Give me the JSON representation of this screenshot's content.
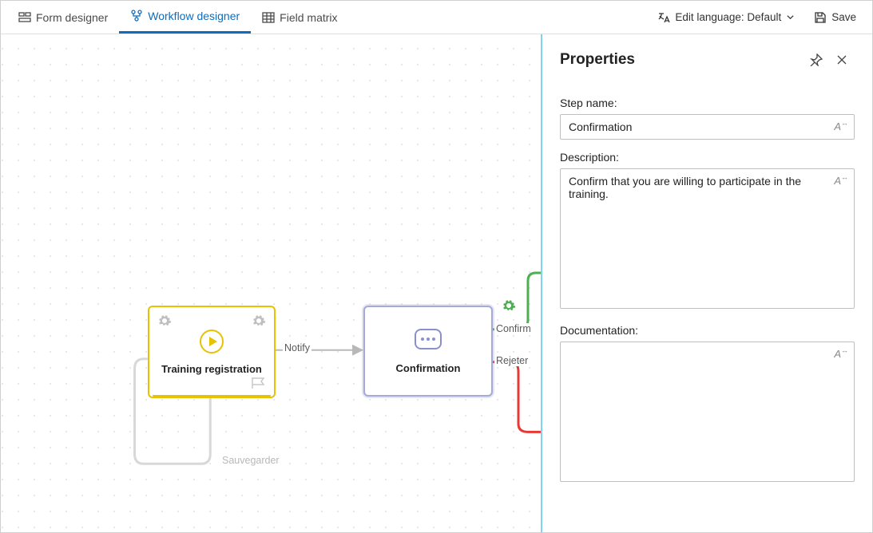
{
  "tabs": {
    "form": {
      "label": "Form designer"
    },
    "workflow": {
      "label": "Workflow designer"
    },
    "matrix": {
      "label": "Field matrix"
    }
  },
  "toolbar": {
    "edit_lang_label": "Edit language: Default",
    "save_label": "Save"
  },
  "canvas": {
    "node_training": {
      "title": "Training registration"
    },
    "node_confirm": {
      "title": "Confirmation"
    },
    "edge_notify": {
      "label": "Notify"
    },
    "edge_save": {
      "label": "Sauvegarder"
    },
    "edge_confirm": {
      "label": "Confirm"
    },
    "edge_reject": {
      "label": "Rejeter"
    }
  },
  "panel": {
    "title": "Properties",
    "step_name_label": "Step name:",
    "step_name_value": "Confirmation",
    "description_label": "Description:",
    "description_value": "Confirm that you are willing to participate in the training.",
    "documentation_label": "Documentation:",
    "documentation_value": ""
  }
}
